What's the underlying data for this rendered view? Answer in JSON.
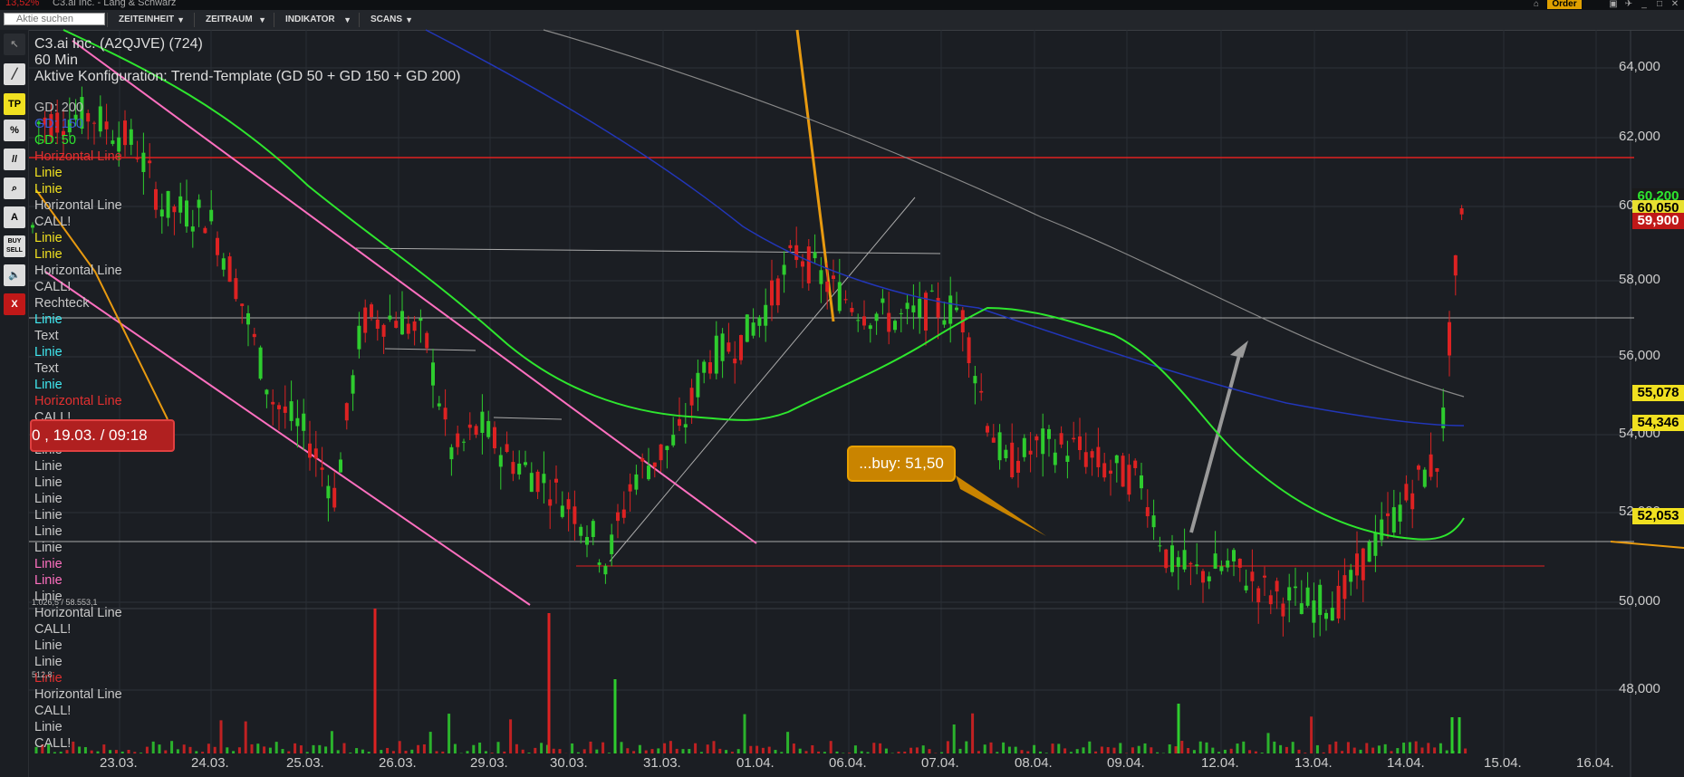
{
  "titlebar": {
    "change": "13,52%",
    "title": "C3.ai Inc. - Lang & Schwarz",
    "order_label": "Order"
  },
  "toolbar": {
    "search_placeholder": "Aktie suchen",
    "menus": [
      {
        "label": "ZEITEINHEIT"
      },
      {
        "label": "ZEITRAUM"
      },
      {
        "label": "INDIKATOR"
      },
      {
        "label": "SCANS"
      }
    ]
  },
  "sidebar": {
    "tools": [
      {
        "icon": "cursor-icon",
        "glyph": "↖"
      },
      {
        "icon": "line-tool-icon",
        "glyph": "╱"
      },
      {
        "icon": "tp-icon",
        "glyph": "TP"
      },
      {
        "icon": "percent-icon",
        "glyph": "%"
      },
      {
        "icon": "parallel-lines-icon",
        "glyph": "//"
      },
      {
        "icon": "zoom-icon",
        "glyph": "⌕"
      },
      {
        "icon": "text-tool-icon",
        "glyph": "A"
      },
      {
        "icon": "buy-sell-icon",
        "glyph": "BUY SELL"
      },
      {
        "icon": "sound-icon",
        "glyph": "🔈"
      },
      {
        "icon": "close-icon",
        "glyph": "X"
      }
    ]
  },
  "chart": {
    "instrument": "C3.ai Inc. (A2QJVE) (724)",
    "timeframe": "60 Min",
    "config": "Aktive Konfiguration: Trend-Template (GD 50 + GD 150 + GD 200)",
    "legend": [
      {
        "text": "GD: 200",
        "color": "#bbbbbb"
      },
      {
        "text": "GD: 150",
        "color": "#3a5bd8"
      },
      {
        "text": "GD: 50",
        "color": "#2ee62e"
      },
      {
        "text": "Horizontal Line",
        "color": "#e03030"
      },
      {
        "text": "Linie",
        "color": "#f0e020"
      },
      {
        "text": "Linie",
        "color": "#f0e020"
      },
      {
        "text": "Horizontal Line",
        "color": "#c8c8c8"
      },
      {
        "text": "CALL!",
        "color": "#c8c8c8"
      },
      {
        "text": "Linie",
        "color": "#f0e020"
      },
      {
        "text": "Linie",
        "color": "#f0e020"
      },
      {
        "text": "Horizontal Line",
        "color": "#c8c8c8"
      },
      {
        "text": "CALL!",
        "color": "#c8c8c8"
      },
      {
        "text": "Rechteck",
        "color": "#c8c8c8"
      },
      {
        "text": "Linie",
        "color": "#40e8f0"
      },
      {
        "text": "Text",
        "color": "#c8c8c8"
      },
      {
        "text": "Linie",
        "color": "#40e8f0"
      },
      {
        "text": "Text",
        "color": "#c8c8c8"
      },
      {
        "text": "Linie",
        "color": "#40e8f0"
      },
      {
        "text": "Horizontal Line",
        "color": "#e03030"
      },
      {
        "text": "CALL!",
        "color": "#c8c8c8"
      },
      {
        "text": "Linie",
        "color": "#c8c8c8"
      },
      {
        "text": "Linie",
        "color": "#c8c8c8"
      },
      {
        "text": "Linie",
        "color": "#c8c8c8"
      },
      {
        "text": "Linie",
        "color": "#c8c8c8"
      },
      {
        "text": "Linie",
        "color": "#c8c8c8"
      },
      {
        "text": "Linie",
        "color": "#c8c8c8"
      },
      {
        "text": "Linie",
        "color": "#c8c8c8"
      },
      {
        "text": "Linie",
        "color": "#c8c8c8"
      },
      {
        "text": "Linie",
        "color": "#ff70c0"
      },
      {
        "text": "Linie",
        "color": "#ff70c0"
      },
      {
        "text": "Linie",
        "color": "#c8c8c8"
      },
      {
        "text": "Horizontal Line",
        "color": "#c8c8c8"
      },
      {
        "text": "CALL!",
        "color": "#c8c8c8"
      },
      {
        "text": "Linie",
        "color": "#c8c8c8"
      },
      {
        "text": "Linie",
        "color": "#c8c8c8"
      },
      {
        "text": "Linie",
        "color": "#e03030"
      },
      {
        "text": "Horizontal Line",
        "color": "#c8c8c8"
      },
      {
        "text": "CALL!",
        "color": "#c8c8c8"
      },
      {
        "text": "Linie",
        "color": "#c8c8c8"
      },
      {
        "text": "CALL!",
        "color": "#c8c8c8"
      }
    ],
    "annotation_date": "0 , 19.03. / 09:18",
    "buy_label": "...buy: 51,50",
    "vol_info": "1.026,5 / 58.553,1",
    "vol_info2": "512,8",
    "y_ticks": [
      "64,000",
      "62,000",
      "60,000",
      "58,000",
      "56,000",
      "54,000",
      "52,000",
      "50,000",
      "48,000"
    ],
    "x_ticks": [
      "23.03.",
      "24.03.",
      "25.03.",
      "26.03.",
      "29.03.",
      "30.03.",
      "31.03.",
      "01.04.",
      "06.04.",
      "07.04.",
      "08.04.",
      "09.04.",
      "12.04.",
      "13.04.",
      "14.04.",
      "15.04.",
      "16.04."
    ],
    "price_labels": [
      {
        "text": "60,200",
        "bg": "#1a1a1a",
        "fg": "#2ee62e"
      },
      {
        "text": "60,050",
        "bg": "#e8e030",
        "fg": "#000000"
      },
      {
        "text": "59,900",
        "bg": "#c01818",
        "fg": "#ffffff"
      },
      {
        "text": "55,078",
        "bg": "#f0e020",
        "fg": "#000000"
      },
      {
        "text": "54,346",
        "bg": "#f0e020",
        "fg": "#000000"
      },
      {
        "text": "52,053",
        "bg": "#f0e020",
        "fg": "#000000"
      }
    ]
  }
}
